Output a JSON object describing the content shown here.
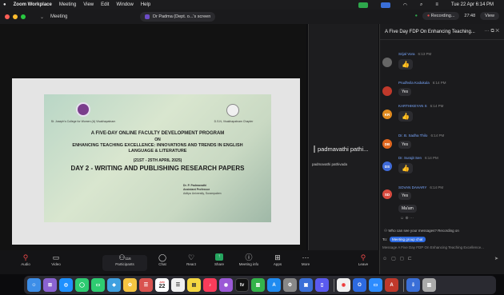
{
  "menubar": {
    "apple": "",
    "app": "Zoom Workplace",
    "items": [
      "Meeting",
      "View",
      "Edit",
      "Window",
      "Help"
    ],
    "clock": "Tue 22 Apr 6:14 PM"
  },
  "titlebar": {
    "meeting_label": "Meeting",
    "shared_screen": "Dr Padma (Dept. o...'s screen",
    "recording": "Recording...",
    "timer": "27:48",
    "view_label": "View"
  },
  "slide": {
    "college": "St. Joseph's College for Women (A) Visakhapatnam",
    "partner": "D.S.N, Visakhapatnam Chapter",
    "line1": "A FIVE-DAY ONLINE FACULTY DEVELOPMENT PROGRAM",
    "line2": "ON",
    "line3": "ENHANCING TEACHING EXCELLENCE: INNOVATIONS AND TRENDS IN ENGLISH LANGUAGE & LITERATURE",
    "dates": "(21ST - 25TH APRIL 2025)",
    "day": "DAY 2 - WRITING AND PUBLISHING RESEARCH PAPERS",
    "presenter_name": "Dr. P. Padmavathi",
    "presenter_title": "Assistant Professor",
    "presenter_org": "Aditya University, Surampalem"
  },
  "participant_tile": {
    "name": "padmavathi pathi...",
    "sub": "padmavathi pathivada"
  },
  "chat": {
    "title": "A Five Day FDP On Enhancing Teaching...",
    "messages": [
      {
        "name": "Srijal Vora",
        "time": "6:13 PM",
        "text": "👍",
        "initials": "",
        "color": "#666"
      },
      {
        "name": "Prudhvila Kodukula",
        "time": "6:14 PM",
        "text": "Yes",
        "initials": "",
        "color": "#c0392b"
      },
      {
        "name": "KARTHIKEYAN S",
        "time": "6:14 PM",
        "text": "👍",
        "initials": "KR",
        "color": "#e08a1e"
      },
      {
        "name": "Dr. B. Sadha Thilo",
        "time": "6:14 PM",
        "text": "Yes",
        "initials": "DB",
        "color": "#e0661e"
      },
      {
        "name": "Dr. Surajit Sen",
        "time": "6:14 PM",
        "text": "👍",
        "initials": "DS",
        "color": "#3f6ad8"
      },
      {
        "name": "SOVAN DAHARY",
        "time": "6:14 PM",
        "text": "Yes",
        "text2": "Ma'am",
        "initials": "SD",
        "color": "#d84a3f"
      }
    ],
    "notice": "Who can see your messages? Recording on",
    "to_label": "To:",
    "to_value": "Meeting group chat",
    "input_placeholder": "Message A Five Day FDP On Enhancing Teaching Excellence..."
  },
  "toolbar": {
    "audio": "Audio",
    "video": "Video",
    "participants": "Participants",
    "participants_count": "116",
    "chat": "Chat",
    "react": "React",
    "share": "Share",
    "meeting_info": "Meeting info",
    "apps": "Apps",
    "more": "More",
    "leave": "Leave"
  },
  "dock": {
    "calendar_month": "APR",
    "calendar_day": "22"
  }
}
